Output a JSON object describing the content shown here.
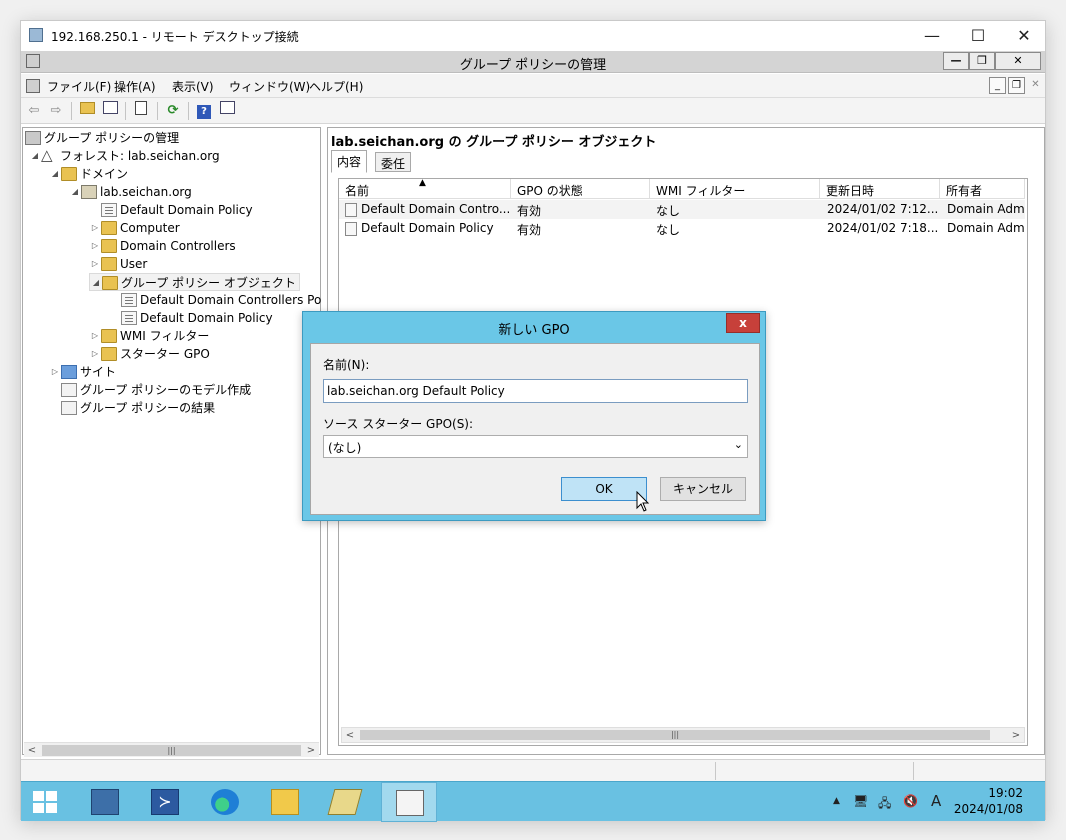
{
  "rdp_window": {
    "title": "192.168.250.1 - リモート デスクトップ接続",
    "minimize": "—",
    "maximize": "☐",
    "close": "✕"
  },
  "mmc": {
    "title": "グループ ポリシーの管理",
    "menu": [
      "ファイル(F)",
      "操作(A)",
      "表示(V)",
      "ウィンドウ(W)",
      "ヘルプ(H)"
    ]
  },
  "tree": {
    "root": "グループ ポリシーの管理",
    "forest": "フォレスト: lab.seichan.org",
    "domains": "ドメイン",
    "domain": "lab.seichan.org",
    "default_domain_policy": "Default Domain Policy",
    "computer": "Computer",
    "domain_controllers": "Domain Controllers",
    "user": "User",
    "gpo_objects": "グループ ポリシー オブジェクト",
    "gpo_child_1": "Default Domain Controllers Po",
    "gpo_child_2": "Default Domain Policy",
    "wmi_filters": "WMI フィルター",
    "starter_gpo": "スターター GPO",
    "sites": "サイト",
    "modeling": "グループ ポリシーのモデル作成",
    "results": "グループ ポリシーの結果",
    "hscroll_thumb": "|||"
  },
  "right_pane": {
    "header": "lab.seichan.org の グループ ポリシー オブジェクト",
    "tabs": [
      "内容",
      "委任"
    ],
    "columns": [
      "名前",
      "GPO の状態",
      "WMI フィルター",
      "更新日時",
      "所有者"
    ],
    "rows": [
      {
        "name": "Default Domain Contro...",
        "status": "有効",
        "wmi": "なし",
        "modified": "2024/01/02 7:12...",
        "owner": "Domain Adm"
      },
      {
        "name": "Default Domain Policy",
        "status": "有効",
        "wmi": "なし",
        "modified": "2024/01/02 7:18...",
        "owner": "Domain Adm"
      }
    ],
    "hscroll_thumb": "|||"
  },
  "dialog": {
    "title": "新しい GPO",
    "close": "x",
    "name_label": "名前(N):",
    "name_value": "lab.seichan.org Default Policy",
    "starter_label": "ソース スターター GPO(S):",
    "starter_value": "(なし)",
    "ok": "OK",
    "cancel": "キャンセル"
  },
  "taskbar": {
    "time": "19:02",
    "date": "2024/01/08",
    "ime": "A"
  },
  "colors": {
    "taskbar": "#69c1e2",
    "dialog_frame": "#6ac7e7",
    "close_red": "#c7403a",
    "folder": "#e9c251"
  }
}
